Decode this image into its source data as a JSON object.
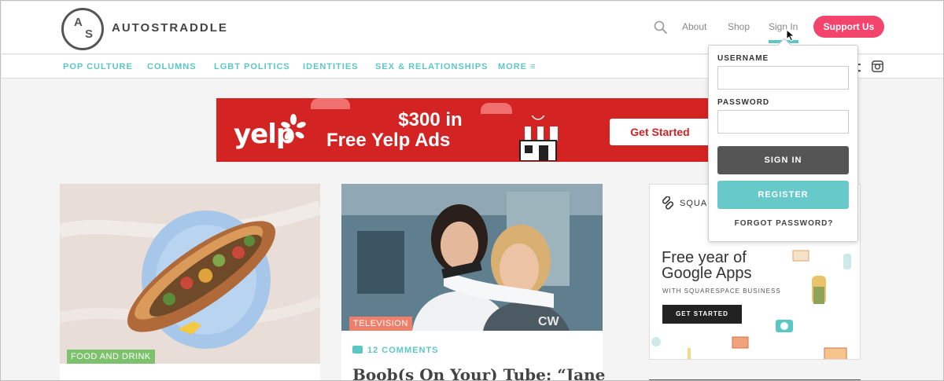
{
  "header": {
    "logo_monogram_top": "A",
    "logo_monogram_bottom": "S",
    "logo_text": "AUTOSTRADDLE",
    "nav": [
      "About",
      "Shop",
      "Sign In"
    ],
    "support_label": "Support Us",
    "accent_color": "#5bc7c5",
    "support_color": "#f2446d"
  },
  "categories": [
    "POP CULTURE",
    "COLUMNS",
    "LGBT POLITICS",
    "IDENTITIES",
    "SEX & RELATIONSHIPS",
    "MORE ≡"
  ],
  "social_icons": [
    "tumblr-icon",
    "instagram-icon"
  ],
  "banner": {
    "brand": "yelp",
    "headline_line1": "$300 in",
    "headline_line2": "Free Yelp Ads",
    "cta": "Get Started",
    "bg_color": "#d32323"
  },
  "cards": [
    {
      "tag": "FOOD AND DRINK",
      "tag_color": "#7cc16b"
    },
    {
      "tag": "TELEVISION",
      "tag_color": "#ef7f6a",
      "comments": "12 COMMENTS",
      "title": "Boob(s On Your) Tube: “Jane"
    }
  ],
  "card2_watermark": "CW",
  "ad": {
    "brand": "SQUARE",
    "line1": "Free year of",
    "line2": "Google Apps",
    "subline": "WITH SQUARESPACE BUSINESS",
    "cta": "GET STARTED"
  },
  "login": {
    "username_label": "USERNAME",
    "username_value": "",
    "password_label": "PASSWORD",
    "password_value": "",
    "signin_label": "SIGN IN",
    "register_label": "REGISTER",
    "forgot_label": "FORGOT PASSWORD?"
  }
}
